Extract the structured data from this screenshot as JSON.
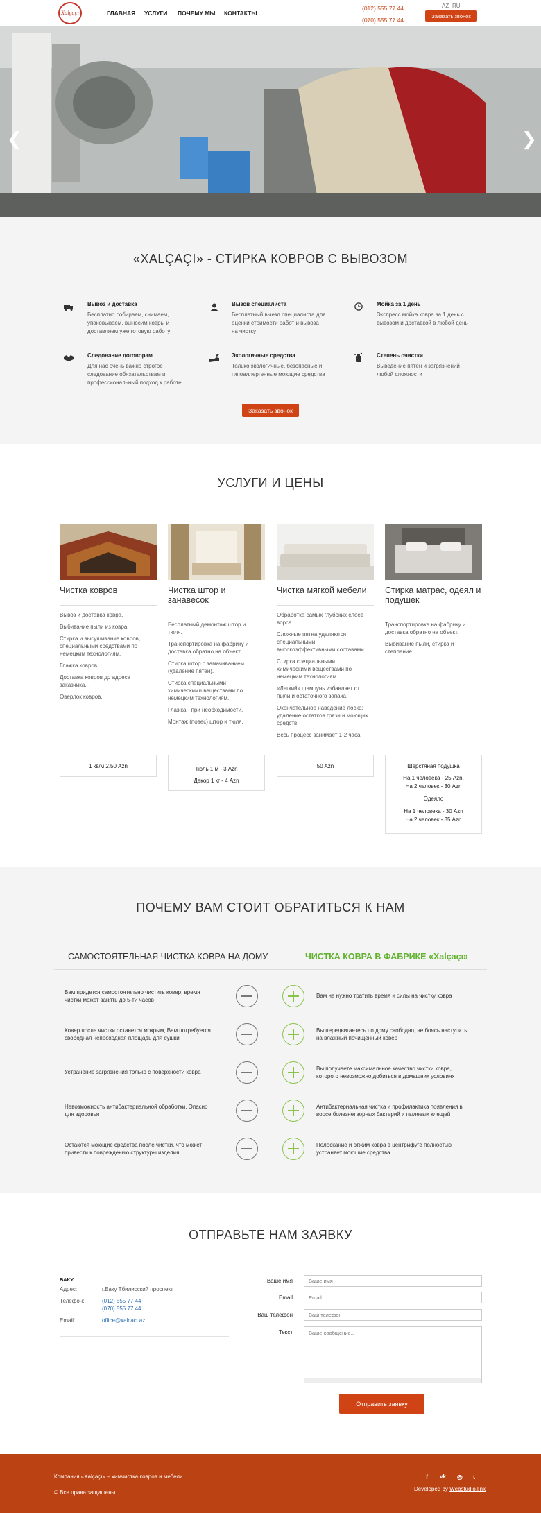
{
  "header": {
    "logo_text": "Xalçaçı",
    "nav": [
      "ГЛАВНАЯ",
      "УСЛУГИ",
      "ПОЧЕМУ МЫ",
      "КОНТАКТЫ"
    ],
    "phones": [
      "(012) 555 77 44",
      "(070) 555 77 44"
    ],
    "langs": [
      "AZ",
      "RU"
    ],
    "call_button": "Заказать звонок"
  },
  "hero": {
    "prev": "❮",
    "next": "❯"
  },
  "about": {
    "title": "«XALÇAÇI» - СТИРКА КОВРОВ С ВЫВОЗОМ",
    "features": [
      {
        "icon": "truck-icon",
        "title": "Вывоз и доставка",
        "text": [
          "Бесплатно собираем, снимаем,",
          "упаковываем, выносим ковры и",
          "доставляем уже готовую работу"
        ]
      },
      {
        "icon": "specialist-icon",
        "title": "Вызов специалиста",
        "text": [
          "Бесплатный выезд специалиста для",
          "оценки стоимости работ и вывоза",
          "на чистку"
        ]
      },
      {
        "icon": "clock-icon",
        "title": "Мойка за 1 день",
        "text": [
          "Экспресс мойка ковра за 1 день с",
          "вывозом и доставкой в любой день"
        ]
      },
      {
        "icon": "handshake-icon",
        "title": "Следование договорам",
        "text": [
          "Для нас очень важно строгое",
          "следование обязательствам и",
          "профессиональный подход к работе"
        ]
      },
      {
        "icon": "eco-hand-icon",
        "title": "Экологичные средства",
        "text": [
          "Только экологичные, безопасные и",
          "гипоаллергенные моющие средства"
        ]
      },
      {
        "icon": "cleaning-icon",
        "title": "Степень очистки",
        "text": [
          "Выведение пятен и загрязнений",
          "любой сложности"
        ]
      }
    ],
    "call_button": "Заказать звонок"
  },
  "services": {
    "title": "УСЛУГИ И ЦЕНЫ",
    "cards": [
      {
        "title": [
          "Чистка ковров"
        ],
        "items": [
          [
            "Вывоз и доставка ковра."
          ],
          [
            "Выбивание пыли из ковра."
          ],
          [
            "Стирка и высушивание ковров,",
            "специальными средствами по",
            "немецким технологиям."
          ],
          [
            "Глажка ковров."
          ],
          [
            "Доставка ковров до адреса",
            "заказчика."
          ],
          [
            "Оверлок ковров."
          ]
        ],
        "price": [
          "1 кв/м 2.50 Azn"
        ]
      },
      {
        "title": [
          "Чистка штор и",
          "занавесок"
        ],
        "items": [
          [
            "Бесплатный демонтаж штор и",
            "тюля."
          ],
          [
            "Транспортировка на фабрику и",
            "доставка обратно на объект."
          ],
          [
            "Стирка штор с замачиванием",
            "(удаление пятен)."
          ],
          [
            "Стирка специальными",
            "химическими веществами по",
            "немецким технологиям."
          ],
          [
            "Глажка - при необходимости."
          ],
          [
            "Монтаж (повес) штор и тюля."
          ]
        ],
        "price": [
          "Тюль 1 м - 3 Azn",
          "Декор 1 кг - 4 Azn"
        ]
      },
      {
        "title": [
          "Чистка мягкой мебели"
        ],
        "items": [
          [
            "Обработка самых глубоких слоев",
            "ворса."
          ],
          [
            "Сложные пятна удаляются",
            "специальными",
            "высокоэффективными составами."
          ],
          [
            "Стирка специальными",
            "химическими веществами по",
            "немецким технологиям."
          ],
          [
            "«Легкий» шампунь избавляет от",
            "пыли и остаточного запаха."
          ],
          [
            "Окончательное наведение лоска:",
            "удаление остатков грязи и моющих",
            "средств."
          ],
          [
            "Весь процесс занимает 1-2 часа."
          ]
        ],
        "price": [
          "50 Azn"
        ]
      },
      {
        "title": [
          "Стирка матрас, одеял и",
          "подушек"
        ],
        "items": [
          [
            "Транспортировка на фабрику и",
            "доставка обратно на объект."
          ],
          [
            "Выбивание пыли, стирка и",
            "степление."
          ]
        ],
        "price": [
          "Шерстяная подушка",
          "На 1 человека - 25 Azn,",
          "На 2 человек - 30 Azn",
          "Одеяло",
          "На 1 человека - 30 Azn",
          "На 2 человек - 35 Azn"
        ]
      }
    ]
  },
  "why": {
    "title": "ПОЧЕМУ ВАМ СТОИТ ОБРАТИТЬСЯ К НАМ",
    "left_title": "САМОСТОЯТЕЛЬНАЯ ЧИСТКА КОВРА НА ДОМУ",
    "right_title": "ЧИСТКА КОВРА В ФАБРИКЕ «Xalçaçı»",
    "left": [
      [
        "Вам придется самостоятельно чистить ковер, время",
        "чистки может занять до 5-ти часов"
      ],
      [
        "Ковер после чистки останется мокрым, Вам потребуется",
        "свободная непроходная площадь для сушки"
      ],
      [
        "Устранение загрязнения только с поверхности ковра"
      ],
      [
        "Невозможность антибактериальной обработки. Опасно",
        "для здоровья"
      ],
      [
        "Остаются моющие средства после чистки, что может",
        "привести к повреждению структуры изделия"
      ]
    ],
    "right": [
      [
        "Вам не нужно тратить время и силы на чистку ковра"
      ],
      [
        "Вы передвигаетесь по дому свободно, не боясь наступить",
        "на влажный почищенный ковер"
      ],
      [
        "Вы получаете максимальное качество чистки ковра,",
        "которого невозможно добиться в домашних условиях"
      ],
      [
        "Антибактериальная чистка и профилактика появления в",
        "ворсе болезнетворных бактерий и пылевых клещей"
      ],
      [
        "Полоскание и отжим ковра в центрифуге полностью",
        "устраняет моющие средства"
      ]
    ]
  },
  "contact": {
    "title": "ОТПРАВЬТЕ НАМ ЗАЯВКУ",
    "city": "БАКУ",
    "address_label": "Адрес:",
    "address": "г.Баку Тбилисский проспект",
    "phone_label": "Телефон:",
    "phones": [
      "(012) 555 77 44",
      "(070) 555 77 44"
    ],
    "email_label": "Email:",
    "email": "office@xalcaci.az",
    "form": {
      "name_label": "Ваше имя",
      "name_placeholder": "Ваше имя",
      "email_label": "Email",
      "email_placeholder": "Email",
      "phone_label": "Ваш телефон",
      "phone_placeholder": "Ваш телефон",
      "text_label": "Текст",
      "text_placeholder": "Ваше сообщение...",
      "submit": "Отправить заявку"
    }
  },
  "footer": {
    "company": "Компания «Xalçaçı» – химчистка ковров и мебели",
    "rights": "© Все права защищены",
    "developed_prefix": "Developed by ",
    "developer": "Webstudio.link",
    "social": [
      "f",
      "vk",
      "◎",
      "t"
    ]
  },
  "colors": {
    "accent": "#cf4314",
    "footer": "#bb4213",
    "green": "#62b22f",
    "link": "#2a6fb3"
  }
}
